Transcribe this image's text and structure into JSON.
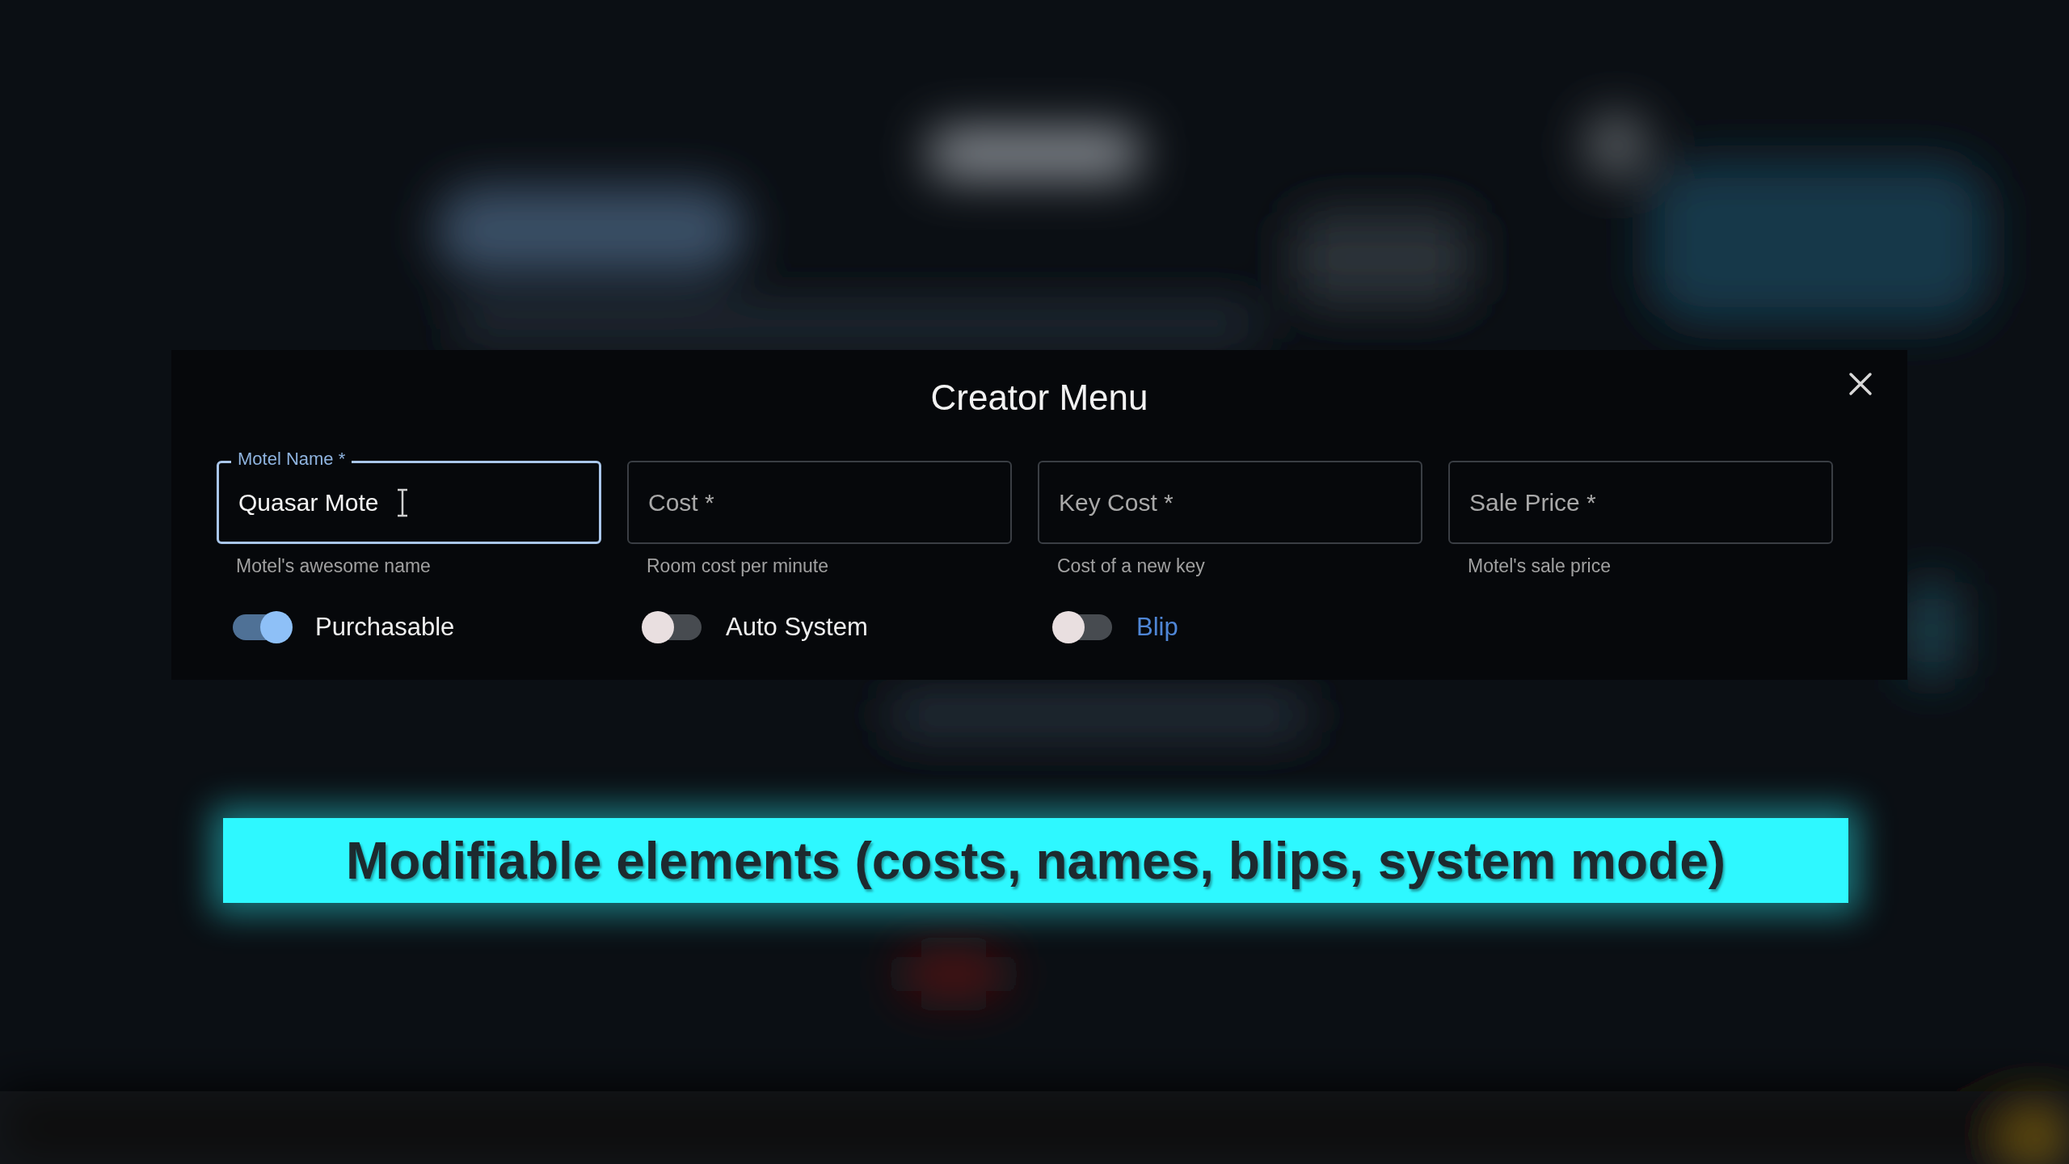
{
  "dialog": {
    "title": "Creator Menu",
    "fields": [
      {
        "label": "Motel Name *",
        "value": "Quasar Mote",
        "focused": true,
        "helper": "Motel's awesome name"
      },
      {
        "label": "Cost *",
        "focused": false,
        "helper": "Room cost per minute"
      },
      {
        "label": "Key Cost *",
        "focused": false,
        "helper": "Cost of a new key"
      },
      {
        "label": "Sale Price *",
        "focused": false,
        "helper": "Motel's sale price"
      }
    ],
    "toggles": [
      {
        "label": "Purchasable",
        "on": true,
        "kind": "label"
      },
      {
        "label": "Auto System",
        "on": false,
        "kind": "label"
      },
      {
        "label": "Blip",
        "on": false,
        "kind": "link"
      }
    ]
  },
  "caption": "Modifiable elements (costs, names, blips, system mode)"
}
